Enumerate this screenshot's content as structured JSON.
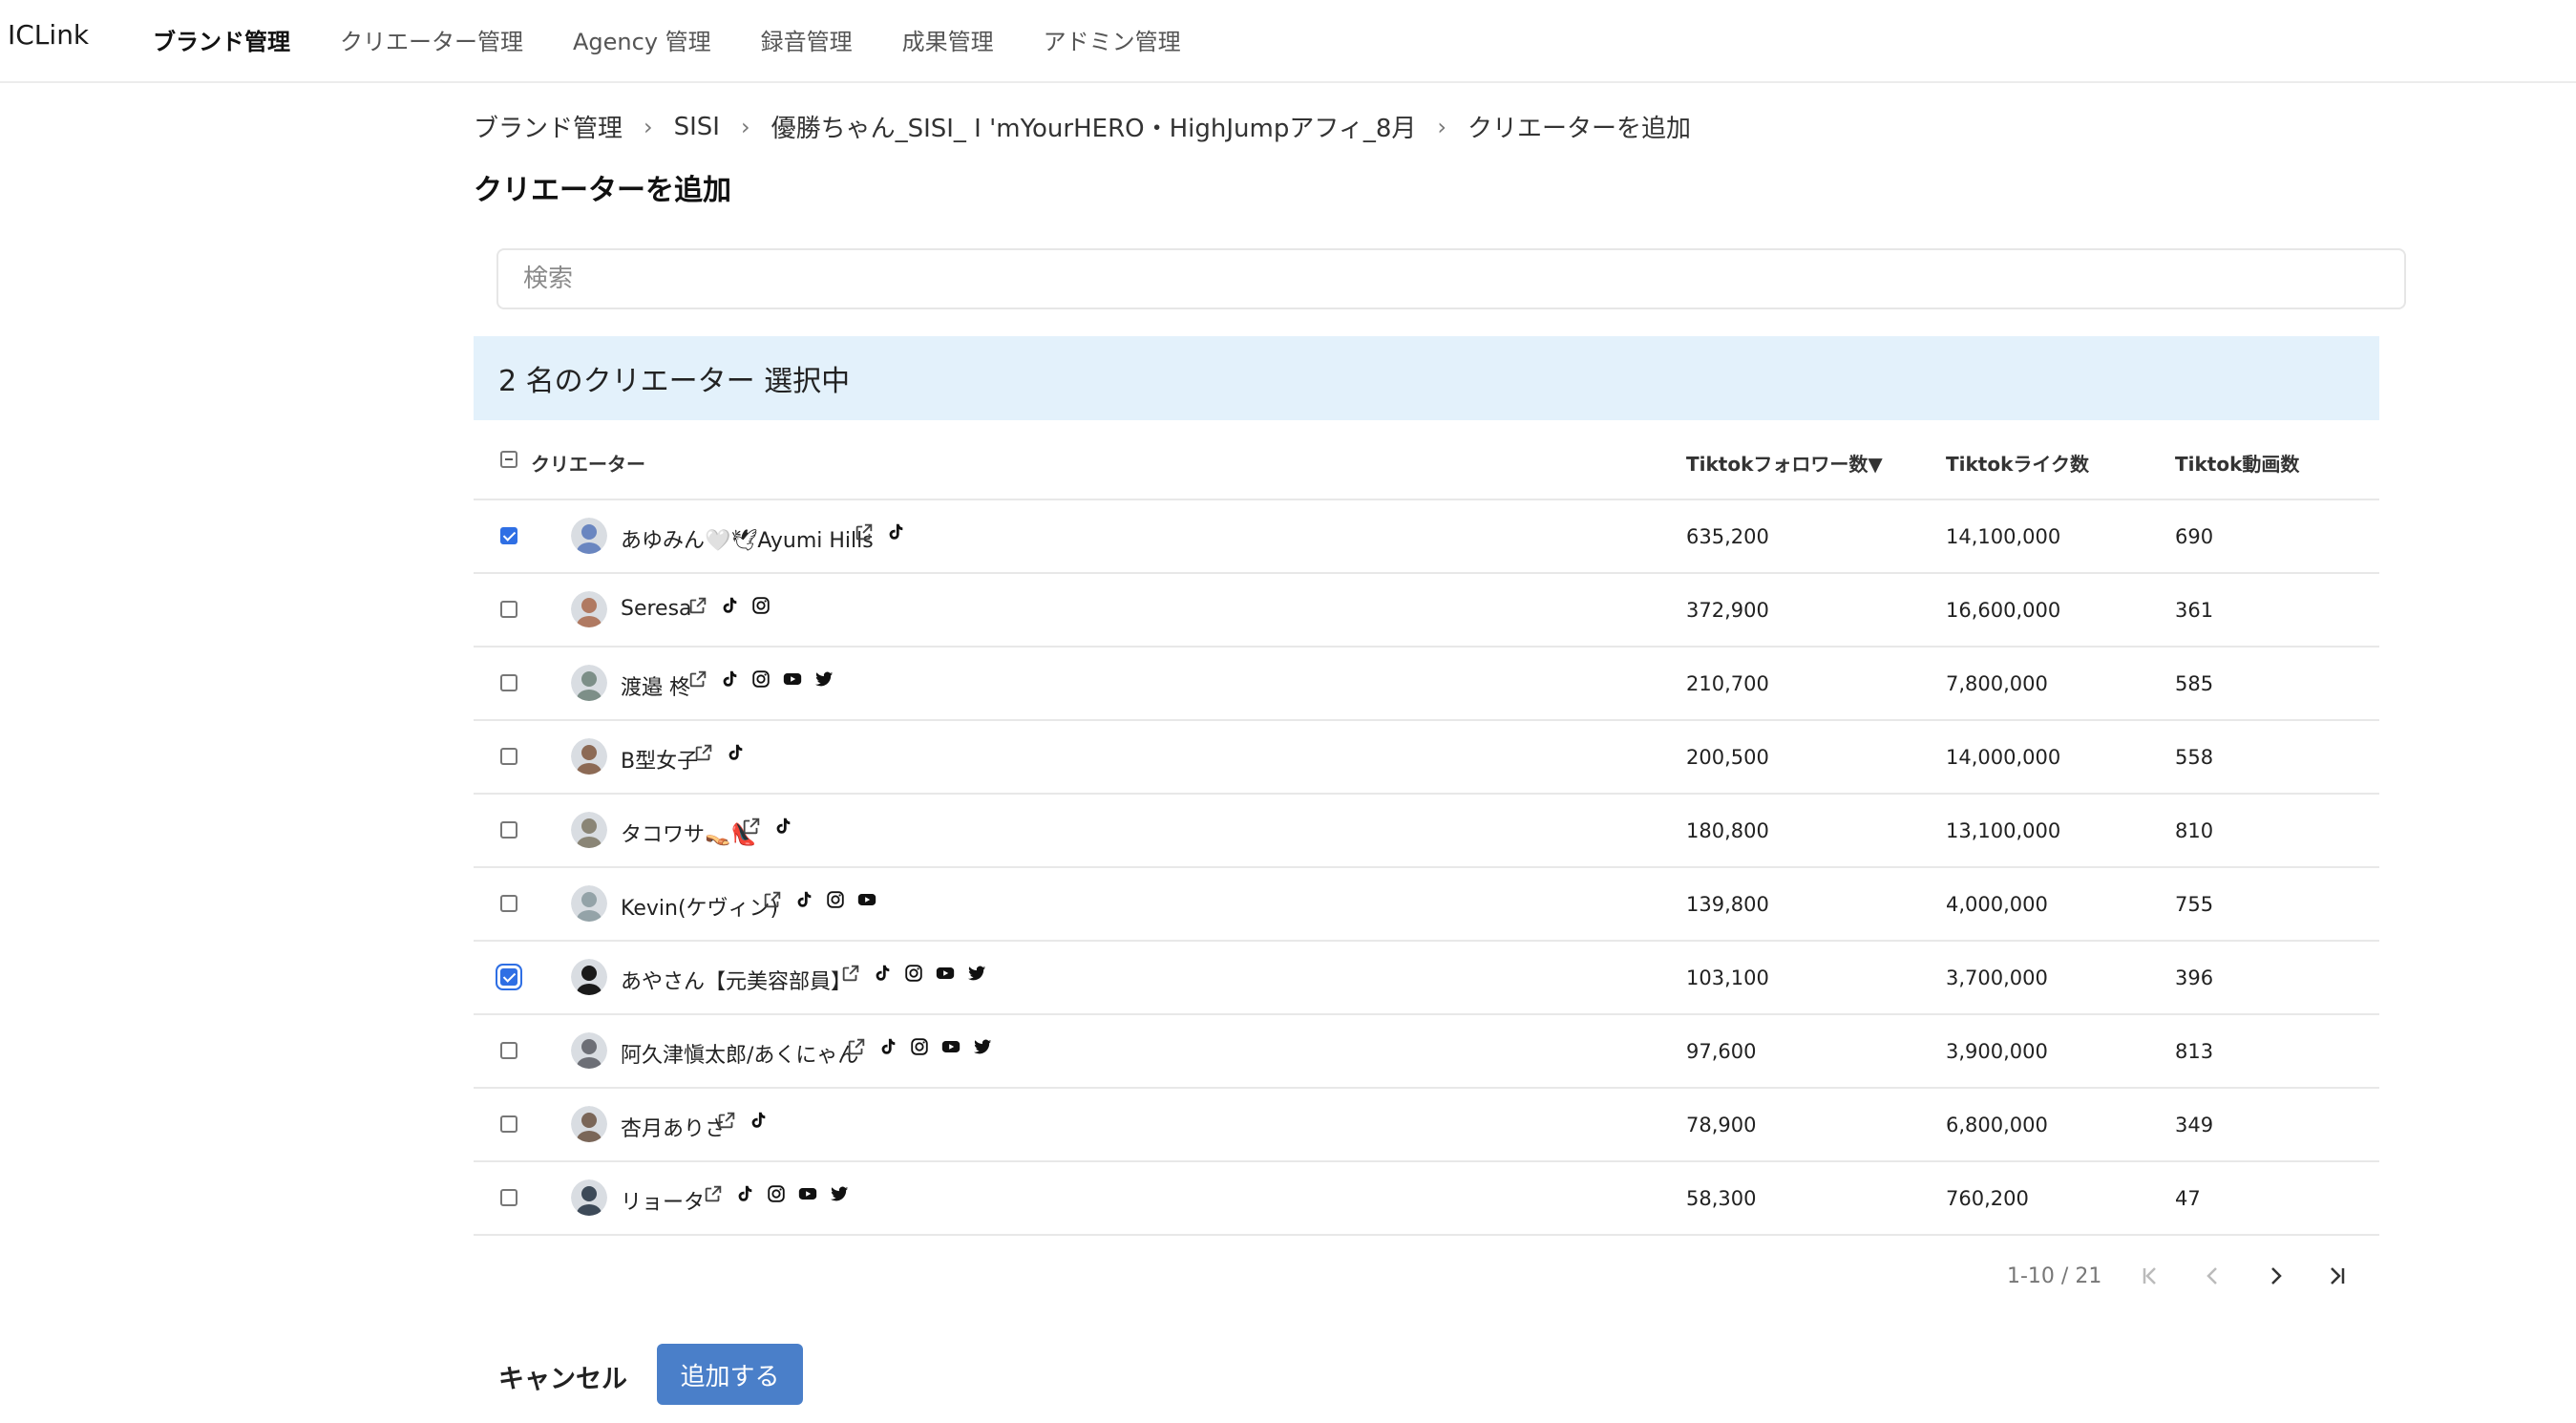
{
  "app": {
    "logo": "ICLink"
  },
  "nav": [
    {
      "label": "ブランド管理",
      "active": true
    },
    {
      "label": "クリエーター管理"
    },
    {
      "label": "Agency 管理"
    },
    {
      "label": "録音管理"
    },
    {
      "label": "成果管理"
    },
    {
      "label": "アドミン管理"
    }
  ],
  "breadcrumb": [
    "ブランド管理",
    "SISI",
    "優勝ちゃん_SISI_ I 'mYourHERO・HighJumpアフィ_8月",
    "クリエーターを追加"
  ],
  "page": {
    "title": "クリエーターを追加"
  },
  "search": {
    "placeholder": "検索",
    "value": ""
  },
  "selection": {
    "text": "2 名のクリエーター 選択中"
  },
  "table": {
    "columns": [
      "クリエーター",
      "Tiktokフォロワー数▼",
      "Tiktokライク数",
      "Tiktok動画数"
    ],
    "rows": [
      {
        "name": "あゆみん🤍🕊Ayumi Hills",
        "followers": "635,200",
        "likes": "14,100,000",
        "videos": "690",
        "checked": true,
        "socials": [
          "external-link",
          "tiktok"
        ],
        "avatar_color": "#6a86c0"
      },
      {
        "name": "Seresa",
        "followers": "372,900",
        "likes": "16,600,000",
        "videos": "361",
        "checked": false,
        "socials": [
          "external-link",
          "tiktok",
          "instagram"
        ],
        "avatar_color": "#b07a62"
      },
      {
        "name": "渡邉 柊",
        "followers": "210,700",
        "likes": "7,800,000",
        "videos": "585",
        "checked": false,
        "socials": [
          "external-link",
          "tiktok",
          "instagram",
          "youtube",
          "twitter"
        ],
        "avatar_color": "#7d8f88"
      },
      {
        "name": "B型女子",
        "followers": "200,500",
        "likes": "14,000,000",
        "videos": "558",
        "checked": false,
        "socials": [
          "external-link",
          "tiktok"
        ],
        "avatar_color": "#8c6a55"
      },
      {
        "name": "タコワサ👡👠",
        "followers": "180,800",
        "likes": "13,100,000",
        "videos": "810",
        "checked": false,
        "socials": [
          "external-link",
          "tiktok"
        ],
        "avatar_color": "#8a8576"
      },
      {
        "name": "Kevin(ケヴィン)",
        "followers": "139,800",
        "likes": "4,000,000",
        "videos": "755",
        "checked": false,
        "socials": [
          "external-link",
          "tiktok",
          "instagram",
          "youtube"
        ],
        "avatar_color": "#94a3a8"
      },
      {
        "name": "あやさん【元美容部員】",
        "followers": "103,100",
        "likes": "3,700,000",
        "videos": "396",
        "checked": true,
        "focus": true,
        "socials": [
          "external-link",
          "tiktok",
          "instagram",
          "youtube",
          "twitter"
        ],
        "avatar_color": "#1a1a1a"
      },
      {
        "name": "阿久津愼太郎/あくにゃん",
        "followers": "97,600",
        "likes": "3,900,000",
        "videos": "813",
        "checked": false,
        "socials": [
          "external-link",
          "tiktok",
          "instagram",
          "youtube",
          "twitter"
        ],
        "avatar_color": "#6d6f76"
      },
      {
        "name": "杏月ありさ",
        "followers": "78,900",
        "likes": "6,800,000",
        "videos": "349",
        "checked": false,
        "socials": [
          "external-link",
          "tiktok"
        ],
        "avatar_color": "#7a6658"
      },
      {
        "name": "リョータ",
        "followers": "58,300",
        "likes": "760,200",
        "videos": "47",
        "checked": false,
        "socials": [
          "external-link",
          "tiktok",
          "instagram",
          "youtube",
          "twitter"
        ],
        "avatar_color": "#3d4a58"
      }
    ]
  },
  "pagination": {
    "range": "1-10 / 21"
  },
  "actions": {
    "cancel": "キャンセル",
    "add": "追加する"
  }
}
